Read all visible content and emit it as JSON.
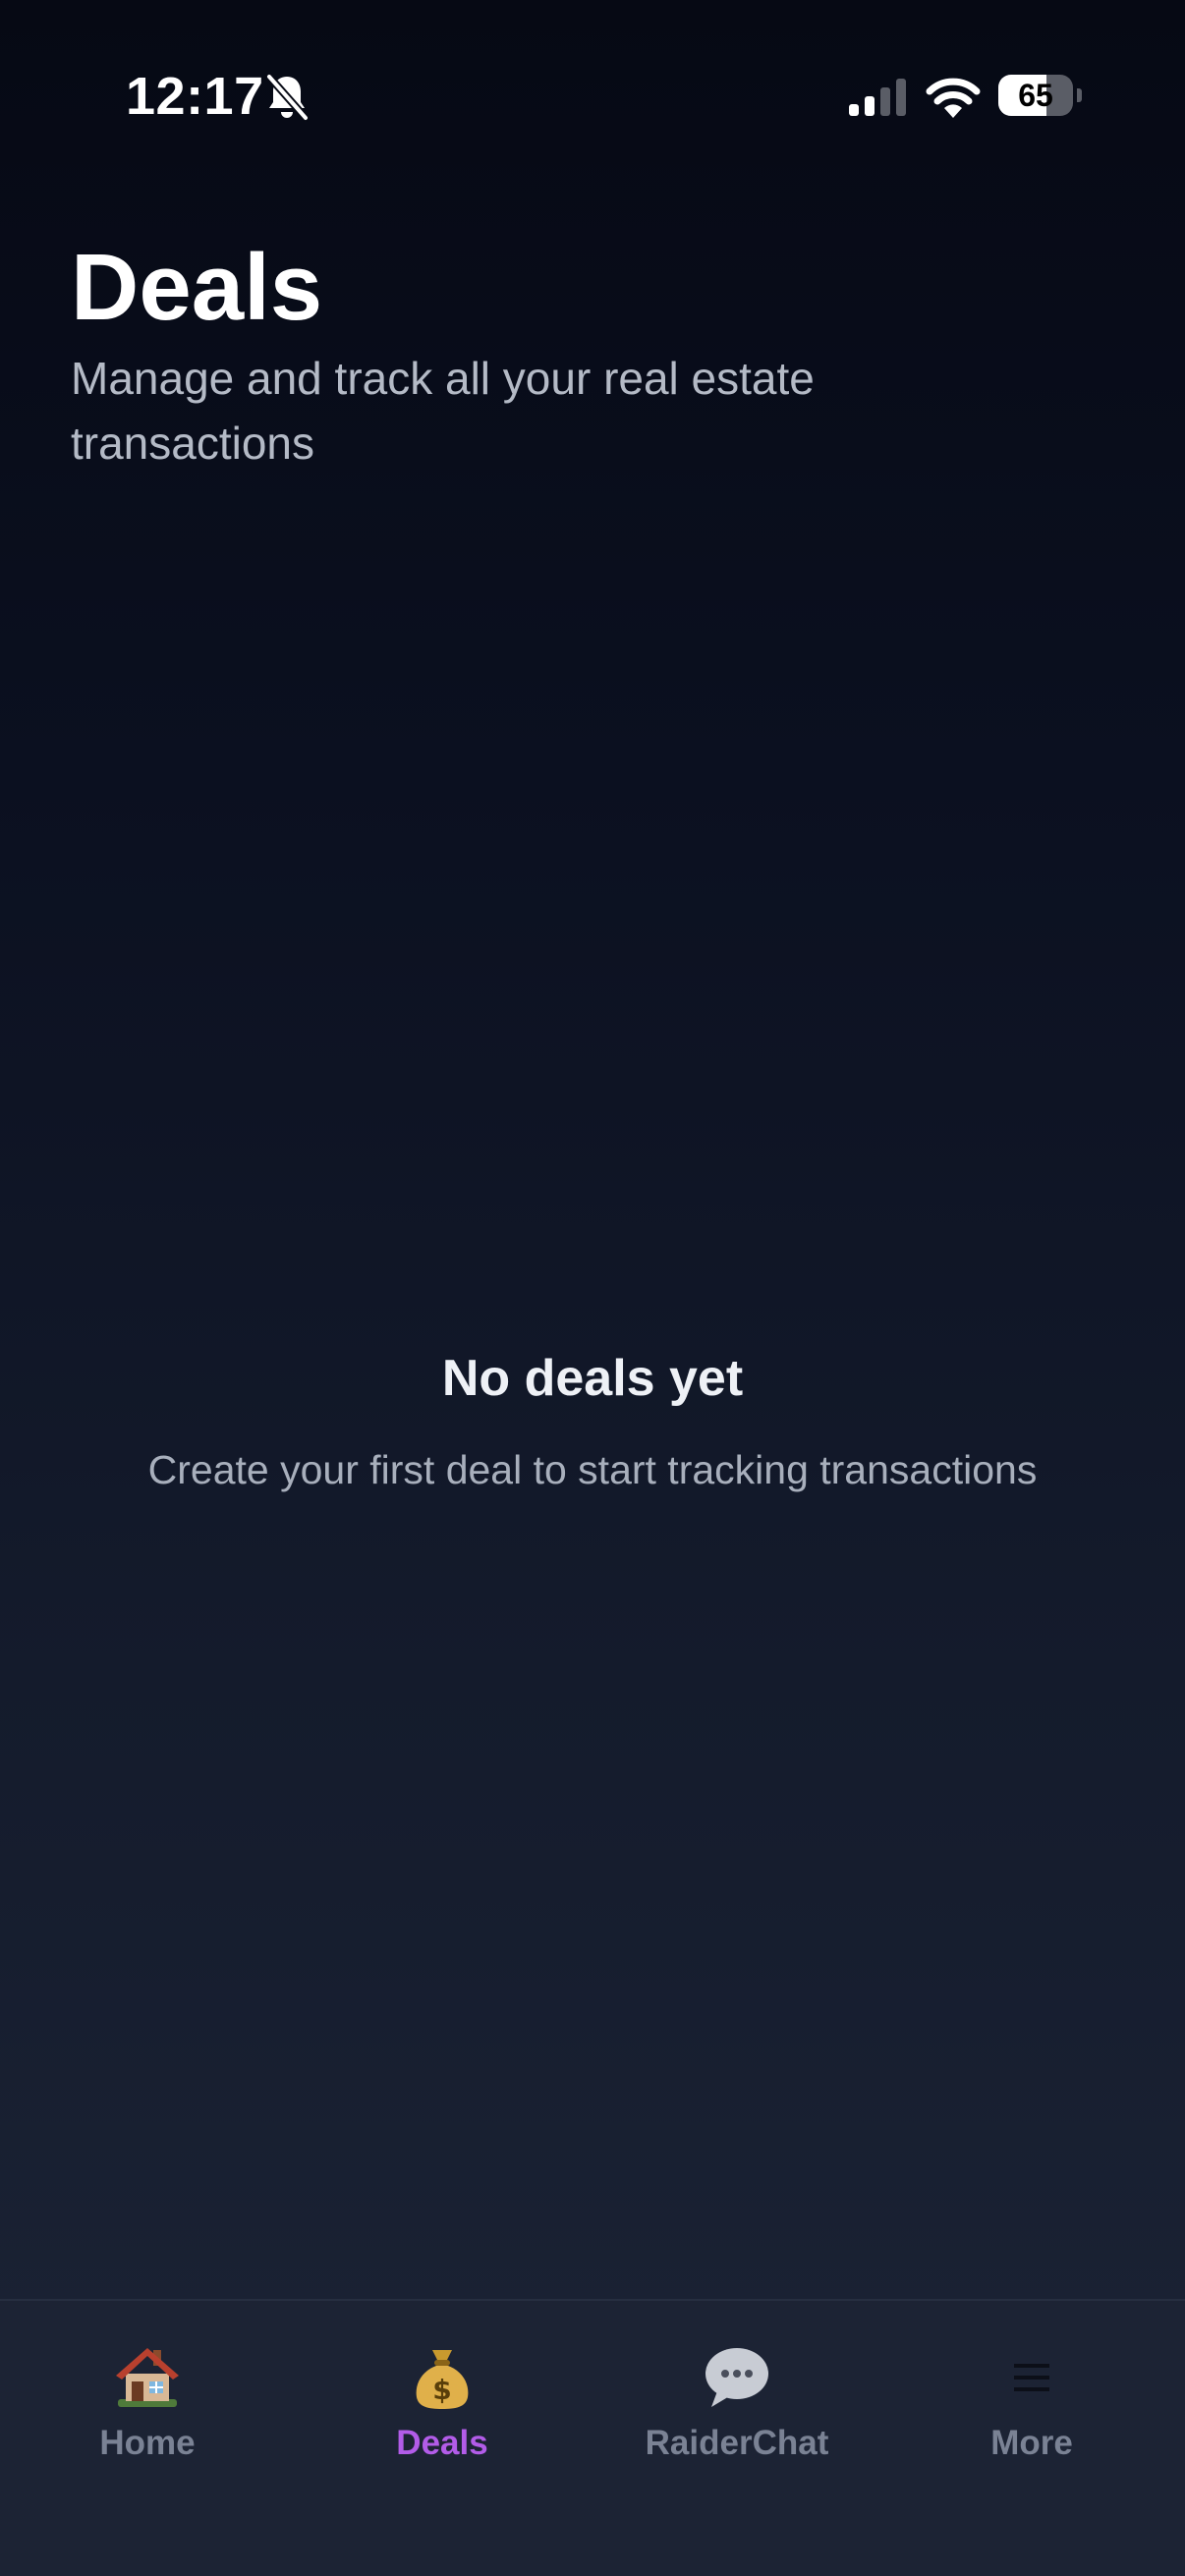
{
  "status_bar": {
    "time": "12:17",
    "battery": "65",
    "battery_level": 0.65
  },
  "header": {
    "title": "Deals",
    "subtitle": "Manage and track all your real estate transactions"
  },
  "empty_state": {
    "title": "No deals yet",
    "message": "Create your first deal to start tracking transactions"
  },
  "tab_bar": {
    "active_tab": "Deals",
    "active_color": "#b25ce8",
    "inactive_color": "#7a8294",
    "tabs": [
      {
        "label": "Home",
        "icon": "house-icon"
      },
      {
        "label": "Deals",
        "icon": "money-bag-icon"
      },
      {
        "label": "RaiderChat",
        "icon": "speech-bubble-icon"
      },
      {
        "label": "More",
        "icon": "menu-icon"
      }
    ]
  }
}
